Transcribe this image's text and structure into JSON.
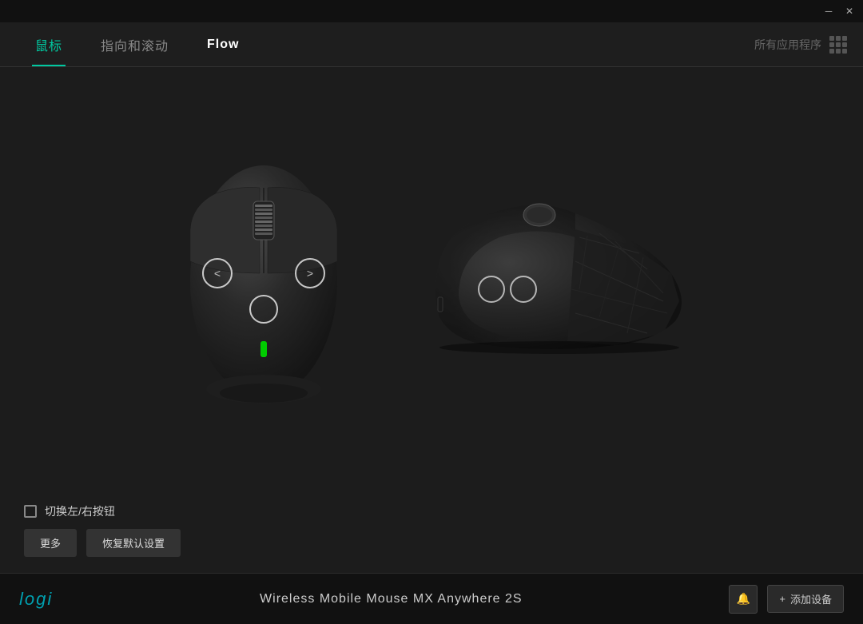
{
  "titlebar": {
    "minimize_label": "─",
    "close_label": "✕"
  },
  "nav": {
    "tab1_label": "鼠标",
    "tab2_label": "指向和滚动",
    "tab3_label": "Flow",
    "all_apps_label": "所有应用程序"
  },
  "controls": {
    "checkbox_label": "切换左/右按钮",
    "more_btn_label": "更多",
    "reset_btn_label": "恢复默认设置"
  },
  "footer": {
    "logo_text": "logi",
    "device_name": "Wireless Mobile Mouse MX Anywhere 2S",
    "add_device_label": "添加设备",
    "add_device_icon": "+"
  }
}
